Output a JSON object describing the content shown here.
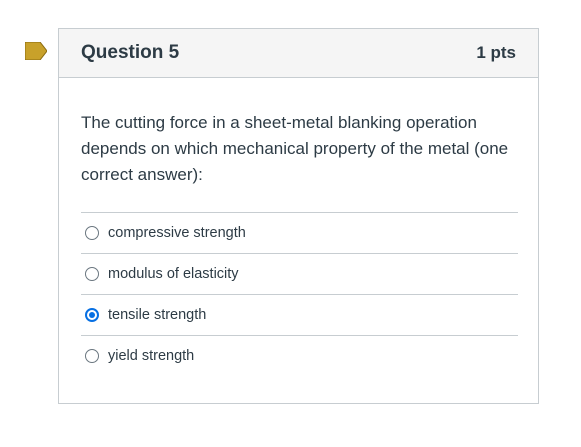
{
  "question": {
    "title": "Question 5",
    "points": "1 pts",
    "text": "The cutting force in a sheet-metal blanking operation depends on which mechanical property of the metal (one correct answer):",
    "flag_color": "#c8a12a",
    "selected_index": 2,
    "answers": [
      {
        "label": "compressive strength",
        "selected": false
      },
      {
        "label": "modulus of elasticity",
        "selected": false
      },
      {
        "label": "tensile strength",
        "selected": true
      },
      {
        "label": "yield strength",
        "selected": false
      }
    ]
  }
}
